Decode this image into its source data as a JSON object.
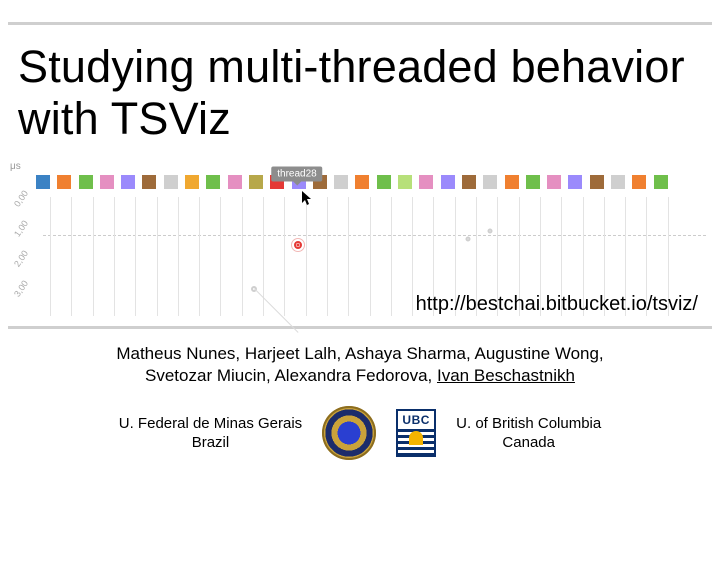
{
  "title": "Studying multi-threaded behavior with TSViz",
  "url": "http://bestchai.bitbucket.io/tsviz/",
  "authors_line1": "Matheus Nunes, Harjeet Lalh, Ashaya Sharma, Augustine Wong,",
  "authors_line2_pre": "Svetozar Miucin, Alexandra Fedorova, ",
  "authors_line2_underlined": "Ivan Beschastnikh",
  "affil_left_name": "U. Federal de Minas Gerais",
  "affil_left_country": "Brazil",
  "affil_right_name": "U. of British Columbia",
  "affil_right_country": "Canada",
  "ubc_label": "UBC",
  "viz": {
    "yaxis_unit": "μs",
    "yticks": [
      "0,00",
      "1,00",
      "2,00",
      "3,00"
    ],
    "tooltip": "thread28",
    "swatch_colors": [
      "#3b82c4",
      "#f08030",
      "#6fbf4b",
      "#e58fc1",
      "#9b8afc",
      "#9e6b3a",
      "#cfcfcf",
      "#f0a830",
      "#6fbf4b",
      "#e58fc1",
      "#b7a84a",
      "#e53935",
      "#9b8afc",
      "#9e6b3a",
      "#cfcfcf",
      "#f08030",
      "#6fbf4b",
      "#b7e07a",
      "#e58fc1",
      "#9b8afc",
      "#9e6b3a",
      "#cfcfcf",
      "#f08030",
      "#6fbf4b",
      "#e58fc1",
      "#9b8afc",
      "#9e6b3a",
      "#cfcfcf",
      "#f08030",
      "#6fbf4b"
    ]
  }
}
